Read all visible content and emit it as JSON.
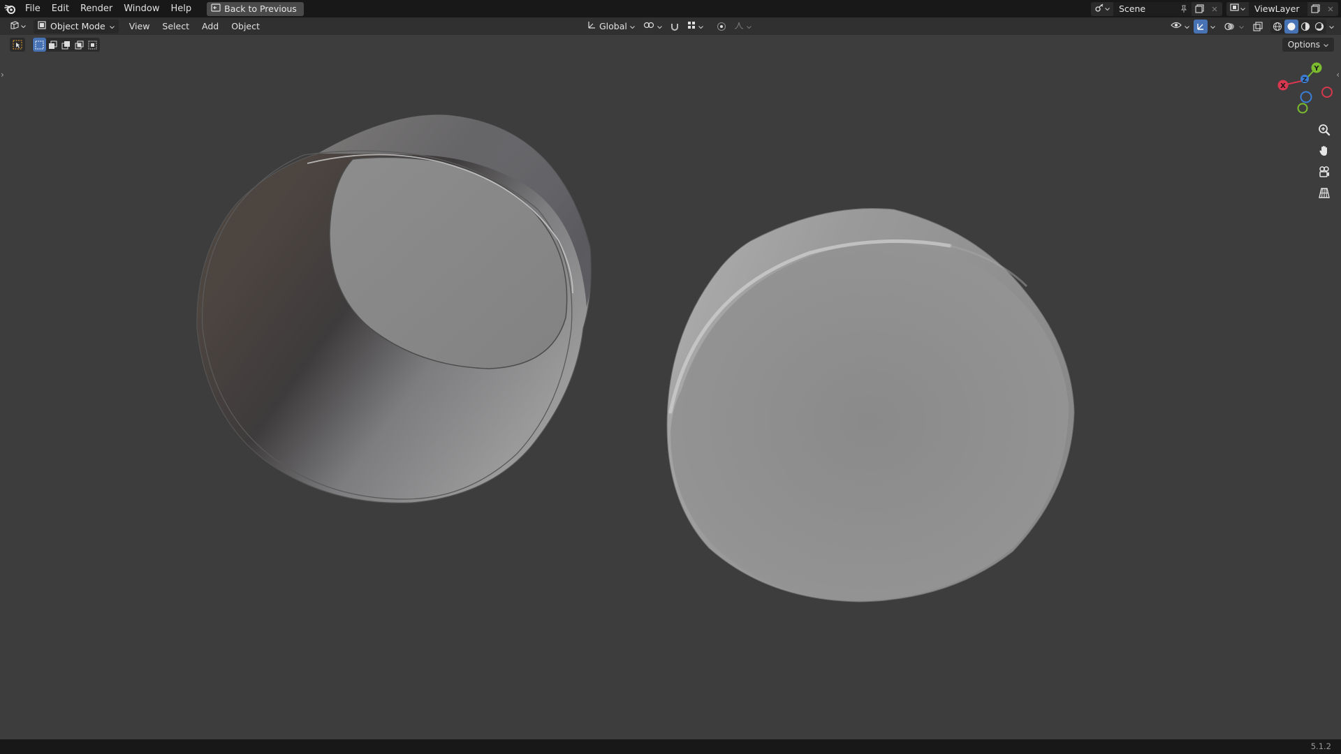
{
  "menu": {
    "items": [
      "File",
      "Edit",
      "Render",
      "Window",
      "Help"
    ],
    "back_label": "Back to Previous"
  },
  "topbar": {
    "scene_name": "Scene",
    "view_layer_name": "ViewLayer"
  },
  "header": {
    "mode_label": "Object Mode",
    "menus": [
      "View",
      "Select",
      "Add",
      "Object"
    ],
    "transform_orientation": "Global",
    "options_label": "Options"
  },
  "gizmo": {
    "x_label": "X",
    "y_label": "Y",
    "z_label": "Z",
    "x_color": "#d9364f",
    "y_color": "#7bbd2e",
    "z_color": "#3c7ed6"
  },
  "status": {
    "version": "5.1.2"
  },
  "theme": {
    "accent": "#4772b3",
    "viewport_bg": "#3d3d3d"
  }
}
